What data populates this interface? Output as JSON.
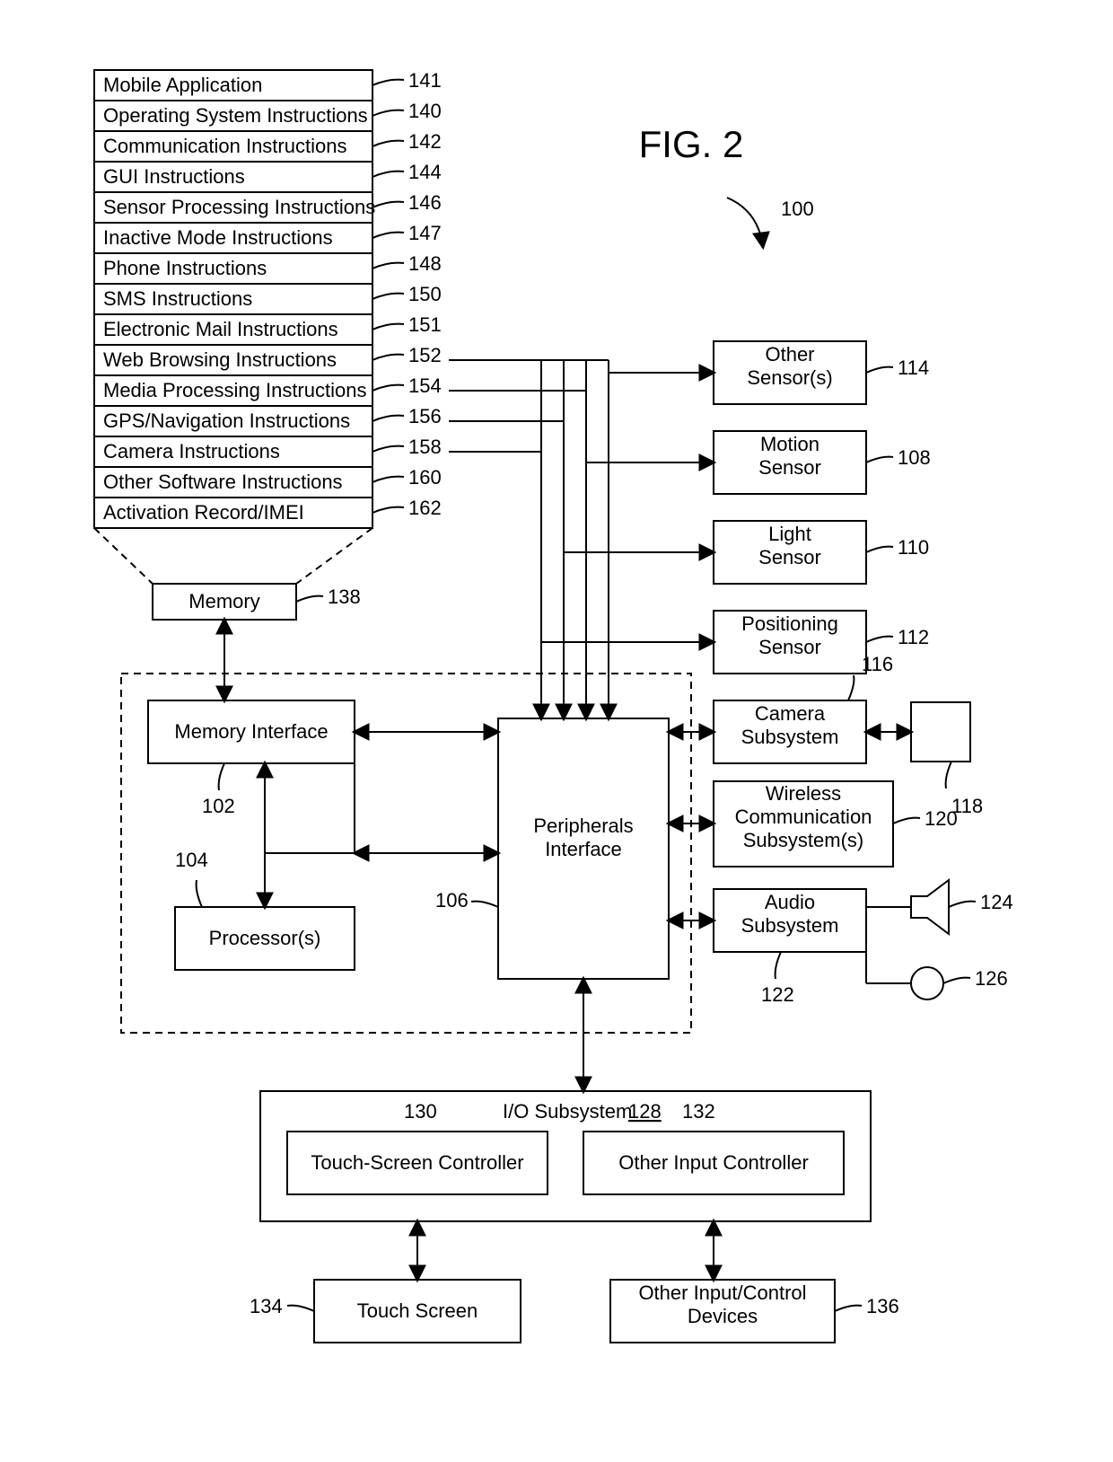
{
  "figure": {
    "title": "FIG. 2",
    "ref": "100"
  },
  "memory": {
    "label": "Memory",
    "ref": "138",
    "rows": [
      {
        "label": "Mobile Application",
        "ref": "141"
      },
      {
        "label": "Operating System Instructions",
        "ref": "140"
      },
      {
        "label": "Communication Instructions",
        "ref": "142"
      },
      {
        "label": "GUI Instructions",
        "ref": "144"
      },
      {
        "label": "Sensor Processing Instructions",
        "ref": "146"
      },
      {
        "label": "Inactive Mode Instructions",
        "ref": "147"
      },
      {
        "label": "Phone Instructions",
        "ref": "148"
      },
      {
        "label": "SMS Instructions",
        "ref": "150"
      },
      {
        "label": "Electronic Mail Instructions",
        "ref": "151"
      },
      {
        "label": "Web Browsing Instructions",
        "ref": "152"
      },
      {
        "label": "Media Processing Instructions",
        "ref": "154"
      },
      {
        "label": "GPS/Navigation Instructions",
        "ref": "156"
      },
      {
        "label": "Camera Instructions",
        "ref": "158"
      },
      {
        "label": "Other Software Instructions",
        "ref": "160"
      },
      {
        "label": "Activation Record/IMEI",
        "ref": "162"
      }
    ]
  },
  "core": {
    "memory_interface": {
      "label": "Memory Interface",
      "ref": "102"
    },
    "processors": {
      "label": "Processor(s)",
      "ref": "104"
    },
    "peripherals_interface": {
      "label": "Peripherals\nInterface",
      "ref": "106"
    }
  },
  "sensors": {
    "other_sensors": {
      "label": "Other\nSensor(s)",
      "ref": "114"
    },
    "motion_sensor": {
      "label": "Motion\nSensor",
      "ref": "108"
    },
    "light_sensor": {
      "label": "Light\nSensor",
      "ref": "110"
    },
    "positioning_sensor": {
      "label": "Positioning\nSensor",
      "ref": "112"
    },
    "camera_subsystem": {
      "label": "Camera\nSubsystem",
      "ref": "116"
    },
    "camera_device_ref": "118",
    "wireless": {
      "label": "Wireless\nCommunication\nSubsystem(s)",
      "ref": "120"
    },
    "audio": {
      "label": "Audio\nSubsystem",
      "ref": "122"
    },
    "speaker_ref": "124",
    "mic_ref": "126"
  },
  "io": {
    "subsystem": {
      "label": "I/O Subsystem",
      "ref": "128"
    },
    "touch_controller": {
      "label": "Touch-Screen Controller",
      "ref": "130"
    },
    "other_controller": {
      "label": "Other Input Controller",
      "ref": "132"
    },
    "touch_screen": {
      "label": "Touch Screen",
      "ref": "134"
    },
    "other_devices": {
      "label": "Other Input/Control\nDevices",
      "ref": "136"
    }
  }
}
